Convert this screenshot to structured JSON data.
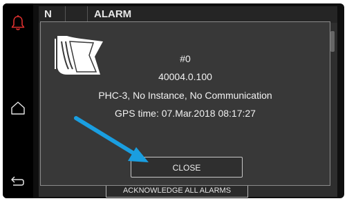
{
  "background": {
    "header_no": "N",
    "header_alarm": "ALARM",
    "acknowledge_all_label": "ACKNOWLEDGE ALL ALARMS"
  },
  "dialog": {
    "alarm_number": "#0",
    "alarm_code": "40004.0.100",
    "alarm_description": "PHC-3, No Instance, No Communication",
    "gps_time": "GPS time: 07.Mar.2018 08:17:27",
    "close_label": "CLOSE"
  },
  "sidebar": {
    "icons": [
      "bell-icon",
      "home-icon",
      "back-arrow-icon"
    ]
  },
  "colors": {
    "alarm_accent": "#e0302f",
    "annotation_arrow": "#1a9ee0",
    "screen_bg": "#0f0f0f",
    "dialog_bg": "#383838"
  }
}
